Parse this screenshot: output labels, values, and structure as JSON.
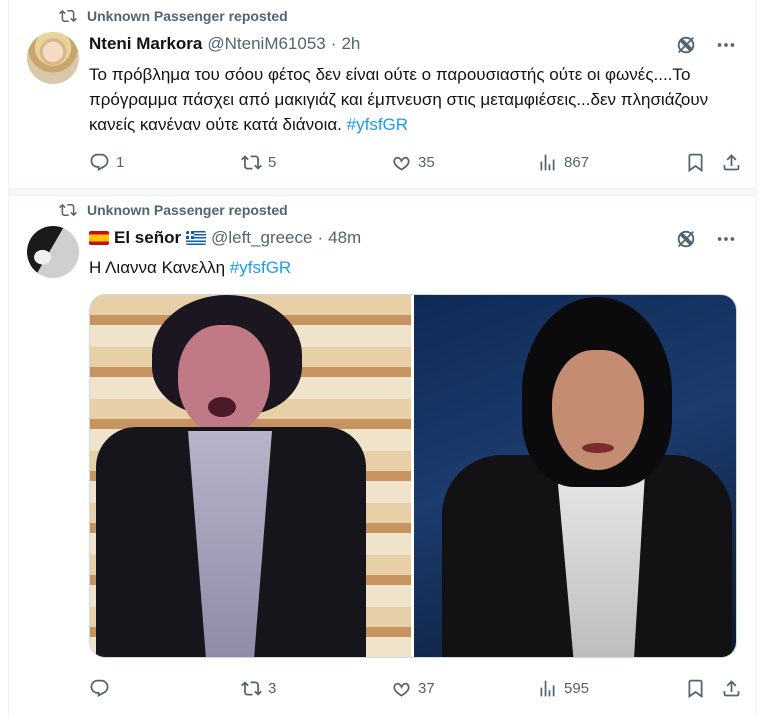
{
  "posts": [
    {
      "repost_label": "Unknown Passenger reposted",
      "author_name": "Nteni Markora",
      "handle": "@NteniM61053",
      "separator": "·",
      "time": "2h",
      "text": "Το πρόβλημα του σόου φέτος δεν είναι ούτε ο παρουσιαστής ούτε οι φωνές....Το πρόγραμμα πάσχει από μακιγιάζ και έμπνευση στις μεταμφιέσεις...δεν πλησιάζουν κανείς κανέναν ούτε κατά διάνοια. ",
      "hashtag": "#yfsfGR",
      "replies": "1",
      "reposts": "5",
      "likes": "35",
      "views": "867"
    },
    {
      "repost_label": "Unknown Passenger reposted",
      "author_name": "El señor",
      "handle": "@left_greece",
      "separator": "·",
      "time": "48m",
      "text": "Η Λιαννα Κανελλη ",
      "hashtag": "#yfsfGR",
      "replies": "",
      "reposts": "3",
      "likes": "37",
      "views": "595"
    }
  ],
  "icons": {
    "repost": "repost-icon",
    "grok": "grok-icon",
    "more": "more-icon",
    "reply": "reply-icon",
    "like": "heart-icon",
    "views": "views-icon",
    "bookmark": "bookmark-icon",
    "share": "share-icon"
  },
  "colors": {
    "accent": "#1d9bf0",
    "secondary_text": "#536471",
    "primary_text": "#0f1419"
  }
}
